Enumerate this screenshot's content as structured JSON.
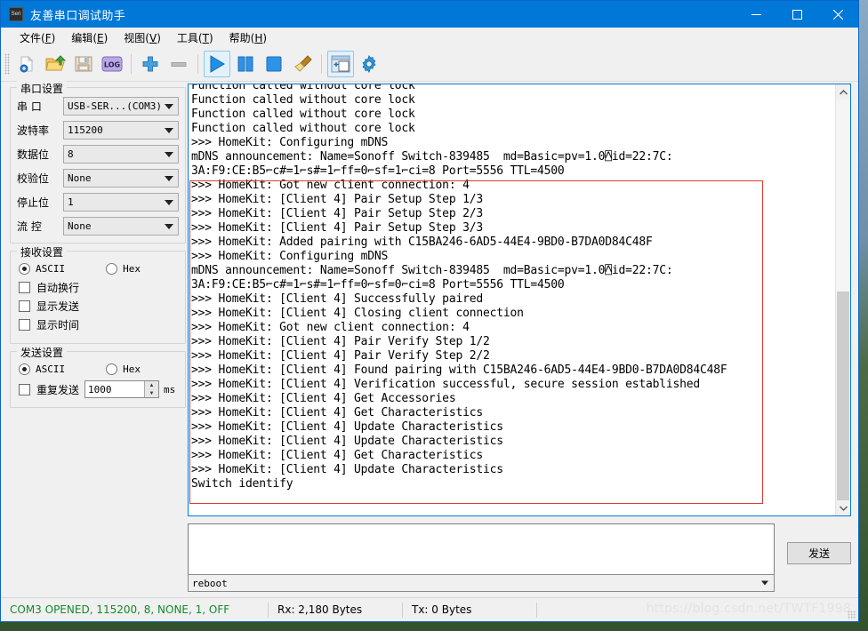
{
  "window": {
    "title": "友善串口调试助手",
    "app_icon": "serial-app-icon",
    "controls": {
      "minimize": "minimize-icon",
      "maximize": "maximize-icon",
      "close": "close-icon"
    }
  },
  "menubar": [
    {
      "label": "文件",
      "accel": "F"
    },
    {
      "label": "编辑",
      "accel": "E"
    },
    {
      "label": "视图",
      "accel": "V"
    },
    {
      "label": "工具",
      "accel": "T"
    },
    {
      "label": "帮助",
      "accel": "H"
    }
  ],
  "toolbar": {
    "buttons": [
      {
        "name": "new-file-icon",
        "active": false
      },
      {
        "name": "open-folder-icon",
        "active": false
      },
      {
        "name": "save-icon",
        "active": false
      },
      {
        "name": "log-icon",
        "active": false
      },
      {
        "name": "add-icon",
        "active": false
      },
      {
        "name": "remove-icon",
        "active": false
      },
      {
        "name": "start-icon",
        "active": true
      },
      {
        "name": "pause-icon",
        "active": false
      },
      {
        "name": "stop-icon",
        "active": false
      },
      {
        "name": "clear-broom-icon",
        "active": false
      },
      {
        "name": "new-window-icon",
        "active": true
      },
      {
        "name": "settings-gear-icon",
        "active": false
      }
    ]
  },
  "sidebar": {
    "port_settings": {
      "legend": "串口设置",
      "fields": [
        {
          "label": "串 口",
          "value": "USB-SER...(COM3)"
        },
        {
          "label": "波特率",
          "value": "115200"
        },
        {
          "label": "数据位",
          "value": "8"
        },
        {
          "label": "校验位",
          "value": "None"
        },
        {
          "label": "停止位",
          "value": "1"
        },
        {
          "label": "流 控",
          "value": "None"
        }
      ]
    },
    "receive_settings": {
      "legend": "接收设置",
      "radio_ascii": "ASCII",
      "radio_hex": "Hex",
      "radio_selected": "ASCII",
      "checkboxes": [
        {
          "label": "自动换行",
          "checked": false
        },
        {
          "label": "显示发送",
          "checked": false
        },
        {
          "label": "显示时间",
          "checked": false
        }
      ]
    },
    "send_settings": {
      "legend": "发送设置",
      "radio_ascii": "ASCII",
      "radio_hex": "Hex",
      "radio_selected": "ASCII",
      "repeat_label": "重复发送",
      "repeat_checked": false,
      "repeat_interval": "1000",
      "repeat_unit": "ms"
    }
  },
  "terminal": {
    "lines": [
      "Function called without core lock",
      "Function called without core lock",
      "Function called without core lock",
      "Function called without core lock",
      ">>> HomeKit: Configuring mDNS",
      "mDNS announcement: Name=Sonoff Switch-839485  md=Basic=pv=1.0⍓id=22:7C:",
      "3A:F9:CE:B5⌐c#=1⌐s#=1⌐ff=0⌐sf=1⌐ci=8 Port=5556 TTL=4500",
      ">>> HomeKit: Got new client connection: 4",
      ">>> HomeKit: [Client 4] Pair Setup Step 1/3",
      ">>> HomeKit: [Client 4] Pair Setup Step 2/3",
      ">>> HomeKit: [Client 4] Pair Setup Step 3/3",
      ">>> HomeKit: Added pairing with C15BA246-6AD5-44E4-9BD0-B7DA0D84C48F",
      ">>> HomeKit: Configuring mDNS",
      "mDNS announcement: Name=Sonoff Switch-839485  md=Basic=pv=1.0⍓id=22:7C:",
      "3A:F9:CE:B5⌐c#=1⌐s#=1⌐ff=0⌐sf=0⌐ci=8 Port=5556 TTL=4500",
      ">>> HomeKit: [Client 4] Successfully paired",
      ">>> HomeKit: [Client 4] Closing client connection",
      ">>> HomeKit: Got new client connection: 4",
      ">>> HomeKit: [Client 4] Pair Verify Step 1/2",
      ">>> HomeKit: [Client 4] Pair Verify Step 2/2",
      ">>> HomeKit: [Client 4] Found pairing with C15BA246-6AD5-44E4-9BD0-B7DA0D84C48F",
      ">>> HomeKit: [Client 4] Verification successful, secure session established",
      ">>> HomeKit: [Client 4] Get Accessories",
      ">>> HomeKit: [Client 4] Get Characteristics",
      ">>> HomeKit: [Client 4] Update Characteristics",
      ">>> HomeKit: [Client 4] Update Characteristics",
      ">>> HomeKit: [Client 4] Get Characteristics",
      ">>> HomeKit: [Client 4] Update Characteristics",
      "Switch identify"
    ],
    "selection_highlight_color": "#e1392d",
    "scrollbar": {
      "up": "scroll-up-icon",
      "down": "scroll-down-icon"
    }
  },
  "send_area": {
    "textarea_value": "",
    "textarea_placeholder": "",
    "send_button": "发送",
    "command_history_value": "reboot"
  },
  "statusbar": {
    "connection": "COM3 OPENED, 115200, 8, NONE, 1, OFF",
    "connection_color": "#128a2a",
    "rx": "Rx: 2,180 Bytes",
    "tx": "Tx: 0 Bytes",
    "watermark": "https://blog.csdn.net/TWTF1998"
  }
}
